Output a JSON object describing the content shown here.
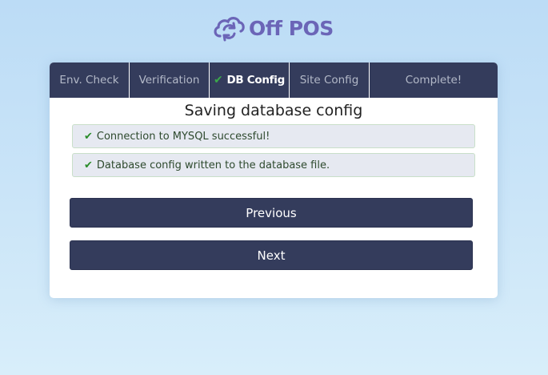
{
  "brand": {
    "name": "Off POS",
    "logo_icon": "cloud-sync-icon",
    "color": "#6b65b7"
  },
  "tabs": [
    {
      "label": "Env. Check",
      "active": false
    },
    {
      "label": "Verification",
      "active": false
    },
    {
      "label": "DB Config",
      "active": true,
      "icon": "check-icon"
    },
    {
      "label": "Site Config",
      "active": false
    },
    {
      "label": "Complete!",
      "active": false
    }
  ],
  "main": {
    "title": "Saving database config",
    "messages": [
      {
        "icon": "check-icon",
        "text": "Connection to MYSQL successful!"
      },
      {
        "icon": "check-icon",
        "text": "Database config written to the database file."
      }
    ],
    "previous_label": "Previous",
    "next_label": "Next"
  },
  "colors": {
    "nav_bg": "#343c5c",
    "check_green": "#2a8c2a",
    "alert_bg": "#e6e9f1"
  }
}
